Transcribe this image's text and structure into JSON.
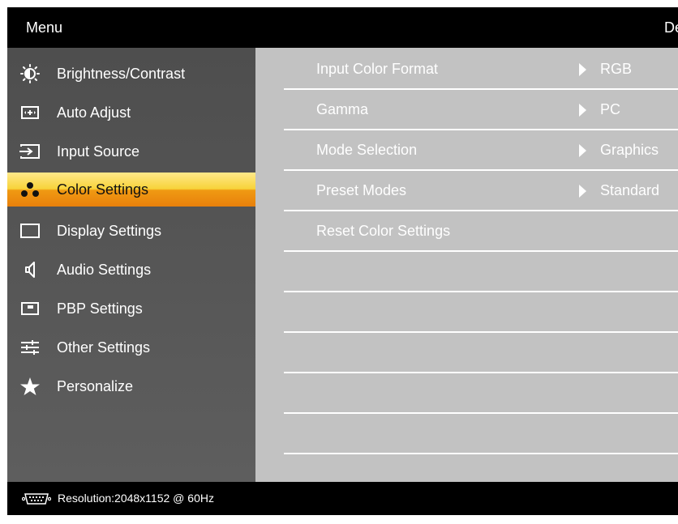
{
  "header": {
    "title": "Menu",
    "brand": "Dell"
  },
  "sidebar": {
    "items": [
      {
        "label": "Brightness/Contrast",
        "icon": "brightness-icon"
      },
      {
        "label": "Auto Adjust",
        "icon": "auto-adjust-icon"
      },
      {
        "label": "Input Source",
        "icon": "input-source-icon"
      },
      {
        "label": "Color Settings",
        "icon": "color-settings-icon",
        "selected": true
      },
      {
        "label": "Display Settings",
        "icon": "display-settings-icon"
      },
      {
        "label": "Audio Settings",
        "icon": "speaker-icon"
      },
      {
        "label": "PBP Settings",
        "icon": "pbp-icon"
      },
      {
        "label": "Other Settings",
        "icon": "sliders-icon"
      },
      {
        "label": "Personalize",
        "icon": "star-icon"
      }
    ]
  },
  "content": {
    "rows": [
      {
        "label": "Input Color Format",
        "value": "RGB"
      },
      {
        "label": "Gamma",
        "value": "PC"
      },
      {
        "label": "Mode Selection",
        "value": "Graphics"
      },
      {
        "label": "Preset Modes",
        "value": "Standard"
      },
      {
        "label": "Reset Color Settings"
      }
    ]
  },
  "footer": {
    "resolution": "Resolution:2048x1152 @ 60Hz",
    "icon": "vga-connector-icon"
  },
  "colors": {
    "selected_top": "#ffe98a",
    "selected_bottom": "#e8800c",
    "sidebar_bg": "#555555",
    "content_bg": "#c2c2c2",
    "bar_bg": "#000000"
  }
}
